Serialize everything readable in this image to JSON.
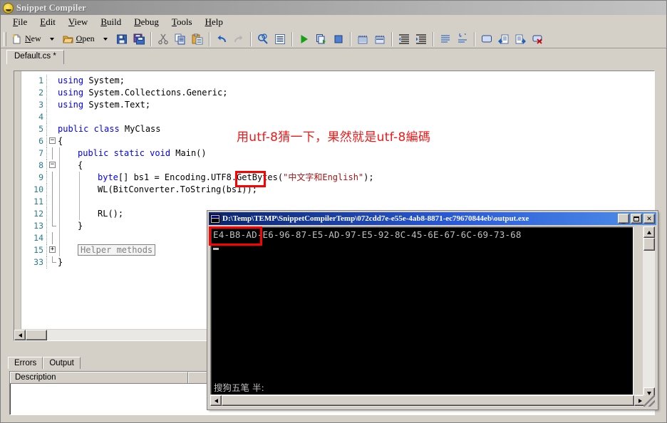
{
  "window": {
    "title": "Snippet Compiler",
    "icon": "app-smiley-icon"
  },
  "menubar": {
    "items": [
      {
        "label": "File",
        "mnemonic": "F"
      },
      {
        "label": "Edit",
        "mnemonic": "E"
      },
      {
        "label": "View",
        "mnemonic": "V"
      },
      {
        "label": "Build",
        "mnemonic": "B"
      },
      {
        "label": "Debug",
        "mnemonic": "D"
      },
      {
        "label": "Tools",
        "mnemonic": "T"
      },
      {
        "label": "Help",
        "mnemonic": "H"
      }
    ]
  },
  "toolbar": {
    "new_label": "New",
    "open_label": "Open",
    "icons": [
      "new-file-icon",
      "new-dropdown-icon",
      "open-folder-icon",
      "open-dropdown-icon",
      "save-icon",
      "save-all-icon",
      "cut-icon",
      "copy-icon",
      "paste-icon",
      "undo-icon",
      "redo-icon",
      "find-icon",
      "properties-icon",
      "run-icon",
      "run-step-icon",
      "stop-icon",
      "add-breakpoint-icon",
      "remove-breakpoints-icon",
      "indent-icon",
      "outdent-icon",
      "comment-icon",
      "uncomment-icon",
      "window-icon",
      "snippet-in-icon",
      "snippet-out-icon",
      "delete-snippet-icon"
    ]
  },
  "document_tabs": [
    {
      "label": "Default.cs *",
      "modified": true,
      "active": true
    }
  ],
  "editor": {
    "lines": [
      {
        "num": "1",
        "fold": "none",
        "indent": 0,
        "segments": [
          {
            "t": "using ",
            "c": "kw"
          },
          {
            "t": "System;",
            "c": ""
          }
        ]
      },
      {
        "num": "2",
        "fold": "none",
        "indent": 0,
        "segments": [
          {
            "t": "using ",
            "c": "kw"
          },
          {
            "t": "System.Collections.Generic;",
            "c": ""
          }
        ]
      },
      {
        "num": "3",
        "fold": "none",
        "indent": 0,
        "segments": [
          {
            "t": "using ",
            "c": "kw"
          },
          {
            "t": "System.Text;",
            "c": ""
          }
        ]
      },
      {
        "num": "4",
        "fold": "none",
        "indent": 0,
        "segments": []
      },
      {
        "num": "5",
        "fold": "none",
        "indent": 0,
        "segments": [
          {
            "t": "public class ",
            "c": "kw"
          },
          {
            "t": "MyClass",
            "c": ""
          }
        ]
      },
      {
        "num": "6",
        "fold": "minus",
        "indent": 0,
        "segments": [
          {
            "t": "{",
            "c": ""
          }
        ]
      },
      {
        "num": "7",
        "fold": "bar",
        "indent": 1,
        "segments": [
          {
            "t": "public static void ",
            "c": "kw"
          },
          {
            "t": "Main()",
            "c": ""
          }
        ]
      },
      {
        "num": "8",
        "fold": "minusbar",
        "indent": 1,
        "segments": [
          {
            "t": "{",
            "c": ""
          }
        ]
      },
      {
        "num": "9",
        "fold": "bar",
        "indent": 2,
        "segments": [
          {
            "t": "byte",
            "c": "kw"
          },
          {
            "t": "[] bs1 = Encoding.UTF8.GetBytes(",
            "c": ""
          },
          {
            "t": "\"",
            "c": "str"
          },
          {
            "t": "中文字和",
            "c": "cjk"
          },
          {
            "t": "English\"",
            "c": "str"
          },
          {
            "t": ");",
            "c": ""
          }
        ]
      },
      {
        "num": "10",
        "fold": "bar",
        "indent": 2,
        "segments": [
          {
            "t": "WL(BitConverter.ToString(bs1));",
            "c": ""
          }
        ]
      },
      {
        "num": "11",
        "fold": "bar",
        "indent": 2,
        "segments": []
      },
      {
        "num": "12",
        "fold": "bar",
        "indent": 2,
        "segments": [
          {
            "t": "RL();",
            "c": ""
          }
        ]
      },
      {
        "num": "13",
        "fold": "endbar",
        "indent": 1,
        "segments": [
          {
            "t": "}",
            "c": ""
          }
        ]
      },
      {
        "num": "14",
        "fold": "bar",
        "indent": 1,
        "segments": []
      },
      {
        "num": "15",
        "fold": "plusbar",
        "indent": 1,
        "segments": [],
        "collapsed_region": "Helper methods"
      },
      {
        "num": "33",
        "fold": "end",
        "indent": 0,
        "segments": [
          {
            "t": "}",
            "c": ""
          }
        ]
      }
    ],
    "annotation": "用utf-8猜一下，果然就是utf-8編碼",
    "highlight_token": "UTF8",
    "colors": {
      "keyword": "#0000ff",
      "string": "#a31515",
      "line_number": "#2b7b8c",
      "annotation": "#f01818",
      "highlight_box": "#ff0000"
    }
  },
  "bottom_panel": {
    "tabs": [
      {
        "label": "Errors",
        "active": true
      },
      {
        "label": "Output",
        "active": false
      }
    ],
    "grid": {
      "columns": [
        "Description"
      ],
      "rows": []
    }
  },
  "console": {
    "title": "D:\\Temp\\TEMP\\SnippetCompilerTemp\\072cdd7e-e55e-4ab8-8871-ec79670844eb\\output.exe",
    "icon": "console-window-icon",
    "buttons": {
      "minimize": "_",
      "maximize": "❐",
      "close": "✕"
    },
    "output_line": "E4-B8-AD-E6-96-87-E5-AD-97-E5-92-8C-45-6E-67-6C-69-73-68",
    "ime_status": "搜狗五笔 半:",
    "scrollbars": {
      "vertical": true,
      "horizontal": true
    }
  }
}
